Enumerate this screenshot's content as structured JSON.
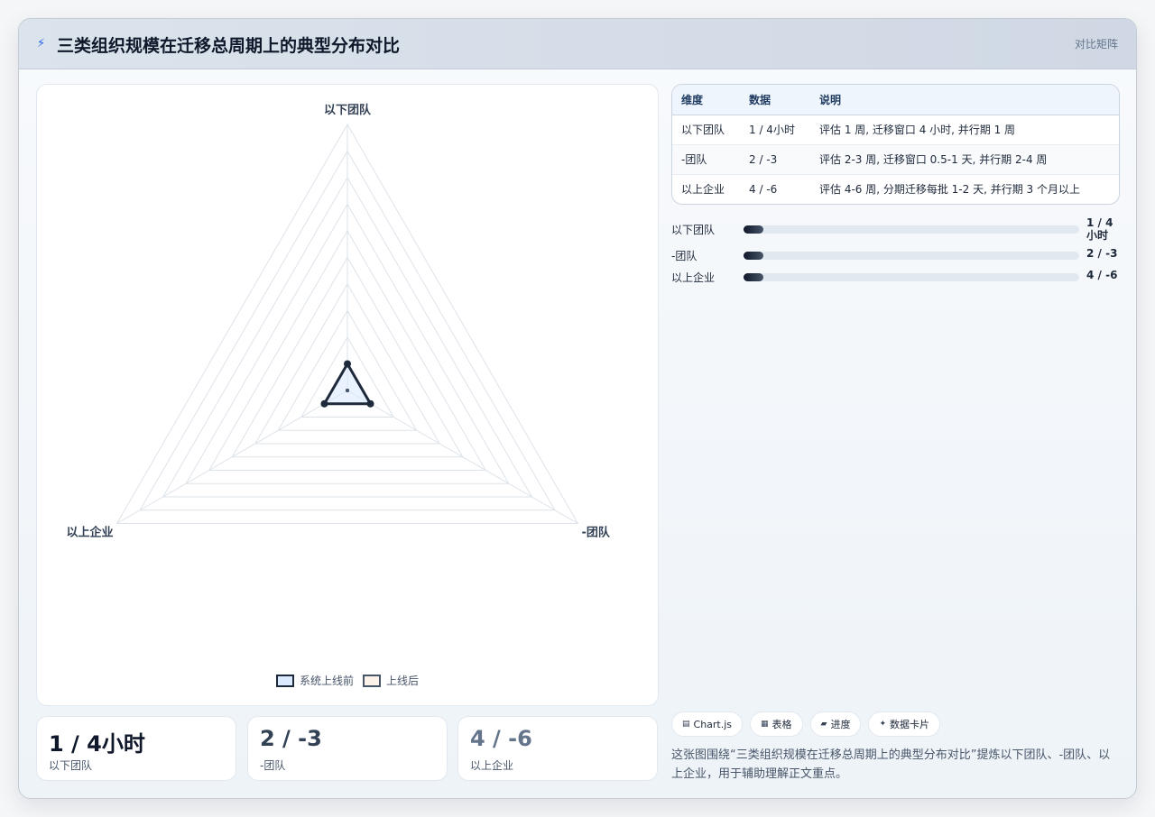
{
  "header": {
    "title": "三类组织规模在迁移总周期上的典型分布对比",
    "tag": "对比矩阵",
    "icon": "bolt-icon"
  },
  "chart_data": {
    "type": "radar",
    "axes": [
      "以下团队",
      "-团队",
      "以上企业"
    ],
    "series": [
      {
        "name": "系统上线前",
        "values": [
          1,
          1,
          1
        ]
      },
      {
        "name": "上线后",
        "values": [
          0,
          0,
          0
        ]
      }
    ],
    "rings": 10,
    "legend": "bottom",
    "colors": {
      "series_a": "#1e293b",
      "series_b": "#475569",
      "grid": "#dde3ea"
    }
  },
  "stats": [
    {
      "value": "1 / 4小时",
      "label": "以下团队",
      "color": "#0f172a"
    },
    {
      "value": "2 / -3",
      "label": "-团队",
      "color": "#334155"
    },
    {
      "value": "4 / -6",
      "label": "以上企业",
      "color": "#64748b"
    }
  ],
  "table": {
    "headers": [
      "维度",
      "数据",
      "说明"
    ],
    "rows": [
      [
        "以下团队",
        "1 / 4小时",
        "评估 1 周, 迁移窗口 4 小时, 并行期 1 周"
      ],
      [
        "-团队",
        "2 / -3",
        "评估 2-3 周, 迁移窗口 0.5-1 天, 并行期 2-4 周"
      ],
      [
        "以上企业",
        "4 / -6",
        "评估 4-6 周, 分期迁移每批 1-2 天, 并行期 3 个月以上"
      ]
    ]
  },
  "bars": [
    {
      "label": "以下团队",
      "value": "1 / 4 小时",
      "fill": 0.06
    },
    {
      "label": "-团队",
      "value": "2 / -3",
      "fill": 0.06
    },
    {
      "label": "以上企业",
      "value": "4 / -6",
      "fill": 0.06
    }
  ],
  "chips": [
    {
      "icon": "▤",
      "label": "Chart.js"
    },
    {
      "icon": "▦",
      "label": "表格"
    },
    {
      "icon": "▰",
      "label": "进度"
    },
    {
      "icon": "✦",
      "label": "数据卡片"
    }
  ],
  "note": "这张图围绕“三类组织规模在迁移总周期上的典型分布对比”提炼以下团队、-团队、以上企业，用于辅助理解正文重点。"
}
